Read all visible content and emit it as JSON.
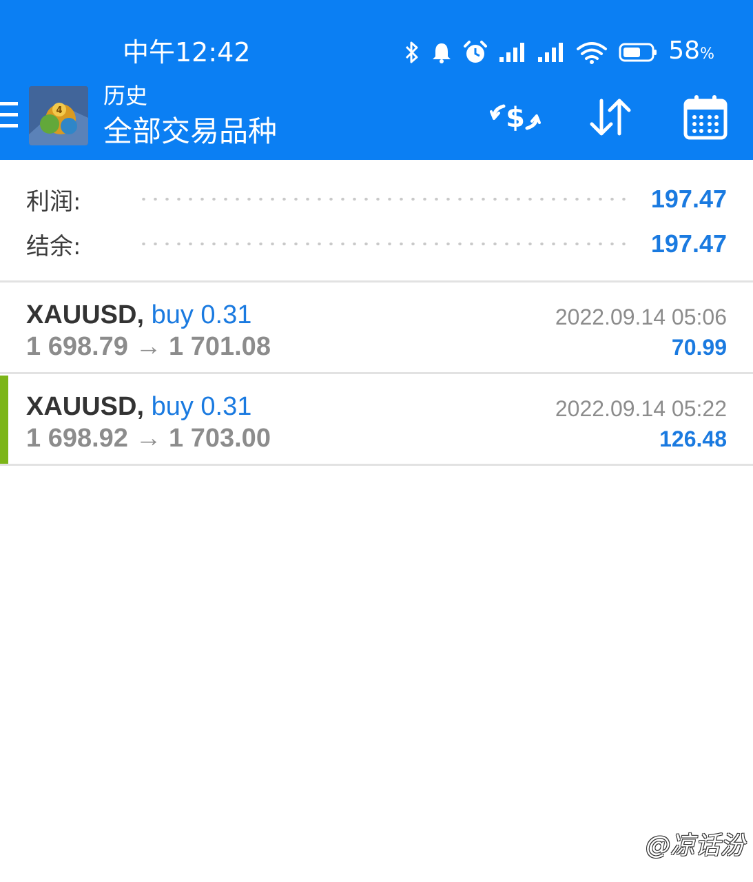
{
  "status_bar": {
    "time": "中午12:42",
    "battery": "58",
    "battery_unit": "%",
    "icons": [
      "bluetooth-icon",
      "bell-icon",
      "alarm-icon",
      "signal-icon",
      "signal-icon",
      "wifi-icon",
      "battery-icon"
    ]
  },
  "toolbar": {
    "subtitle": "历史",
    "title": "全部交易品种",
    "icons": [
      "menu-icon",
      "app-logo",
      "currency-exchange-icon",
      "sort-icon",
      "calendar-icon"
    ]
  },
  "summary": {
    "profit_label": "利润:",
    "profit_value": "197.47",
    "balance_label": "结余:",
    "balance_value": "197.47"
  },
  "deals": [
    {
      "symbol": "XAUUSD,",
      "side": "buy 0.31",
      "prices": "1 698.79 → 1 701.08",
      "time": "2022.09.14 05:06",
      "profit": "70.99",
      "selected": false
    },
    {
      "symbol": "XAUUSD,",
      "side": "buy 0.31",
      "prices": "1 698.92 → 1 703.00",
      "time": "2022.09.14 05:22",
      "profit": "126.48",
      "selected": true
    }
  ],
  "watermark": "@凉话汾",
  "colors": {
    "header_bg": "#0b7ff3",
    "accent_blue": "#1a7ae0",
    "selected_bar": "#7cb518"
  }
}
